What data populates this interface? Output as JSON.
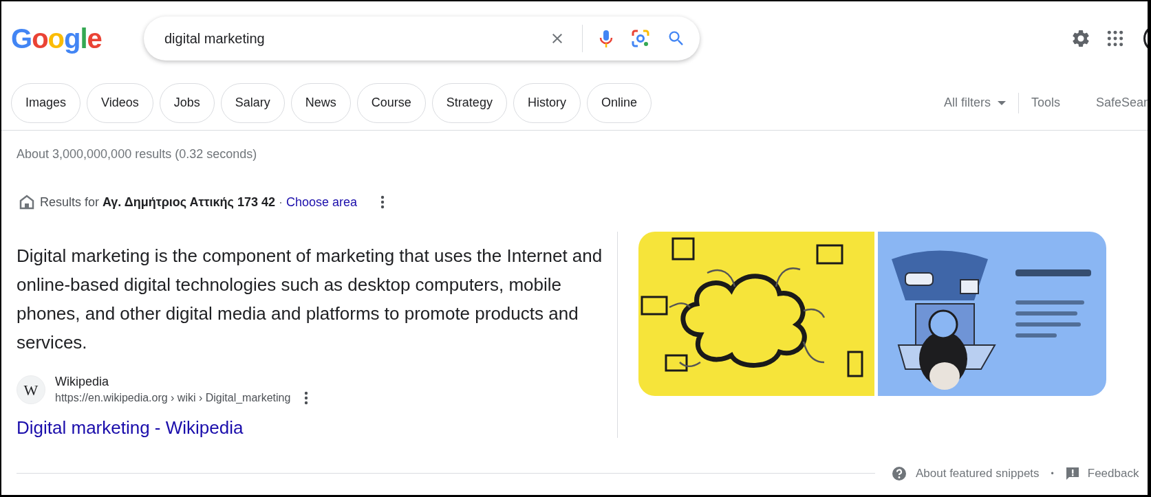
{
  "logo": {
    "text": "Google"
  },
  "search": {
    "value": "digital marketing"
  },
  "filters": [
    {
      "label": "Images",
      "selected": false
    },
    {
      "label": "Videos",
      "selected": false
    },
    {
      "label": "Jobs",
      "selected": false
    },
    {
      "label": "Salary",
      "selected": false
    },
    {
      "label": "News",
      "selected": false
    },
    {
      "label": "Course",
      "selected": false
    },
    {
      "label": "Strategy",
      "selected": false
    },
    {
      "label": "History",
      "selected": false
    },
    {
      "label": "Online",
      "selected": false
    }
  ],
  "tools": {
    "all_filters": "All filters",
    "tools": "Tools",
    "safesearch": "SafeSear"
  },
  "result_stats": "About 3,000,000,000 results (0.32 seconds)",
  "location": {
    "prefix": "Results for",
    "place": "Αγ. Δημήτριος Αττικής 173 42",
    "separator": "·",
    "link": "Choose area"
  },
  "snippet": {
    "text": "Digital marketing is the component of marketing that uses the Internet and online-based digital technologies such as desktop computers, mobile phones, and other digital media and platforms to promote products and services.",
    "source": {
      "favicon": "W",
      "site": "Wikipedia",
      "url": "https://en.wikipedia.org › wiki › Digital_marketing"
    },
    "title": "Digital marketing - Wikipedia"
  },
  "footer": {
    "about": "About featured snippets",
    "separator": "•",
    "feedback": "Feedback"
  }
}
